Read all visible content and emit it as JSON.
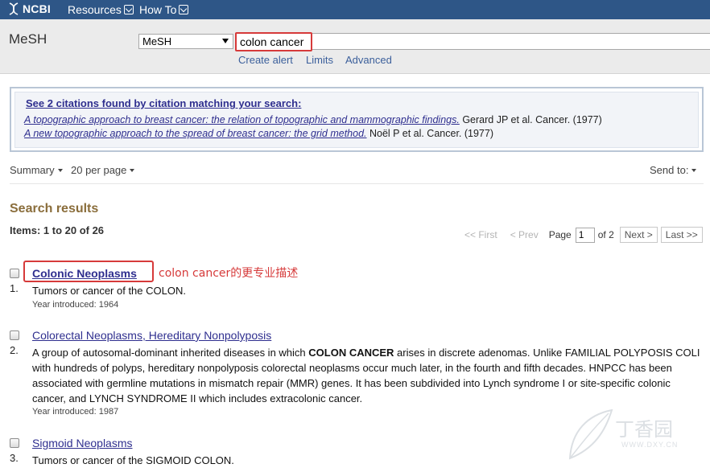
{
  "topbar": {
    "brand": "NCBI",
    "menu": [
      {
        "label": "Resources"
      },
      {
        "label": "How To"
      }
    ]
  },
  "search": {
    "db_title": "MeSH",
    "db_selected": "MeSH",
    "term": "colon cancer",
    "links": [
      "Create alert",
      "Limits",
      "Advanced"
    ]
  },
  "citation_match": {
    "heading": "See 2 citations found by citation matching your search:",
    "items": [
      {
        "title": "A topographic approach to breast cancer: the relation of topographic and mammographic findings.",
        "meta": " Gerard JP et al. Cancer. (1977)"
      },
      {
        "title": "A new topographic approach to the spread of breast cancer: the grid method.",
        "meta": " Noël P et al. Cancer. (1977)"
      }
    ]
  },
  "display": {
    "format": "Summary",
    "per_page": "20 per page",
    "send_to": "Send to:"
  },
  "results": {
    "heading": "Search results",
    "items_label": "Items: 1 to 20 of 26"
  },
  "pager": {
    "first": "<< First",
    "prev": "< Prev",
    "page_label": "Page",
    "page_value": "1",
    "of_label": "of 2",
    "next": "Next >",
    "last": "Last >>"
  },
  "annotation": {
    "text": "colon cancer的更专业描述",
    "color": "#d63a3a"
  },
  "records": [
    {
      "num": "1.",
      "title": "Colonic Neoplasms",
      "desc": "Tumors or cancer of the COLON.",
      "year": "Year introduced: 1964"
    },
    {
      "num": "2.",
      "title": "Colorectal Neoplasms, Hereditary Nonpolyposis",
      "desc_pre": "A group of autosomal-dominant inherited diseases in which ",
      "desc_bold": "COLON CANCER",
      "desc_post": " arises in discrete adenomas. Unlike FAMILIAL POLYPOSIS COLI with hundreds of polyps, hereditary nonpolyposis colorectal neoplasms occur much later, in the fourth and fifth decades. HNPCC has been associated with germline mutations in mismatch repair (MMR) genes. It has been subdivided into Lynch syndrome I or site-specific colonic cancer, and LYNCH SYNDROME II which includes extracolonic cancer.",
      "year": "Year introduced: 1987"
    },
    {
      "num": "3.",
      "title": "Sigmoid Neoplasms",
      "desc": "Tumors or cancer of the SIGMOID COLON."
    }
  ],
  "watermark": {
    "text": "丁香园",
    "url": "WWW.DXY.CN"
  },
  "colors": {
    "topbar": "#2e5687",
    "link": "#2f2f8f",
    "highlight_red": "#d63a3a",
    "results_heading": "#8a6d3b"
  },
  "icons": [
    "ncbi-helix-icon",
    "chevron-down-icon",
    "dropdown-arrow-icon",
    "caret-down-icon"
  ]
}
